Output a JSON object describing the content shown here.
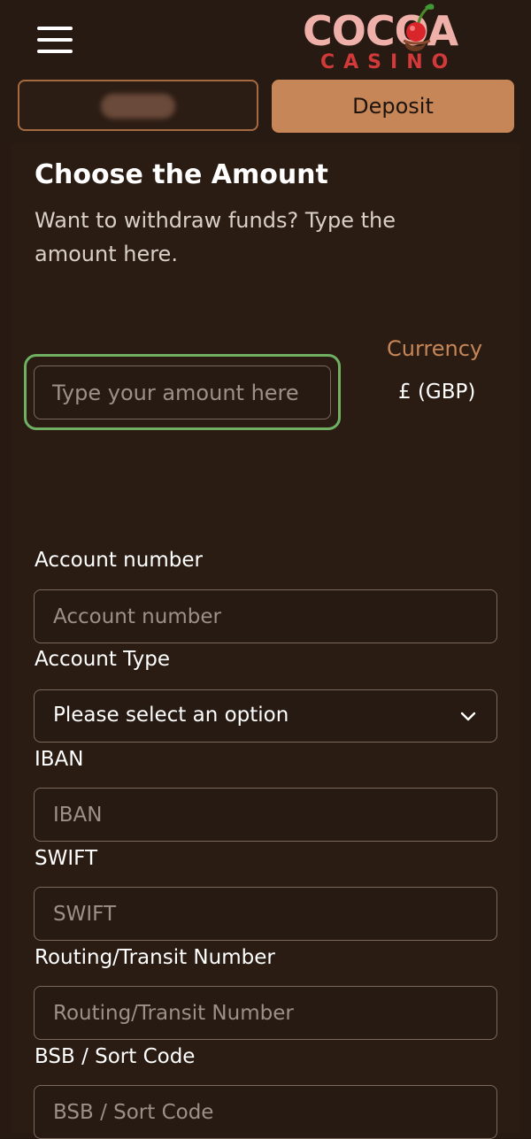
{
  "header": {
    "logo_top": "COCOA",
    "logo_bottom": "CASINO",
    "deposit_label": "Deposit"
  },
  "form": {
    "title": "Choose the Amount",
    "subtitle": "Want to withdraw funds? Type the amount here.",
    "amount_placeholder": "Type your amount here",
    "currency_label": "Currency",
    "currency_value": "£ (GBP)",
    "fields": [
      {
        "label": "Account number",
        "placeholder": "Account number"
      },
      {
        "label": "Account Type",
        "selected": "Please select an option"
      },
      {
        "label": "IBAN",
        "placeholder": "IBAN"
      },
      {
        "label": "SWIFT",
        "placeholder": "SWIFT"
      },
      {
        "label": "Routing/Transit Number",
        "placeholder": "Routing/Transit Number"
      },
      {
        "label": "BSB / Sort Code",
        "placeholder": "BSB / Sort Code"
      }
    ]
  },
  "colors": {
    "background": "#271a12",
    "accent": "#c78657",
    "focus_ring": "#6fb063",
    "logo_red": "#d23a3a"
  },
  "icons": [
    "hamburger-menu-icon",
    "cherry-icon",
    "chevron-down-icon"
  ]
}
